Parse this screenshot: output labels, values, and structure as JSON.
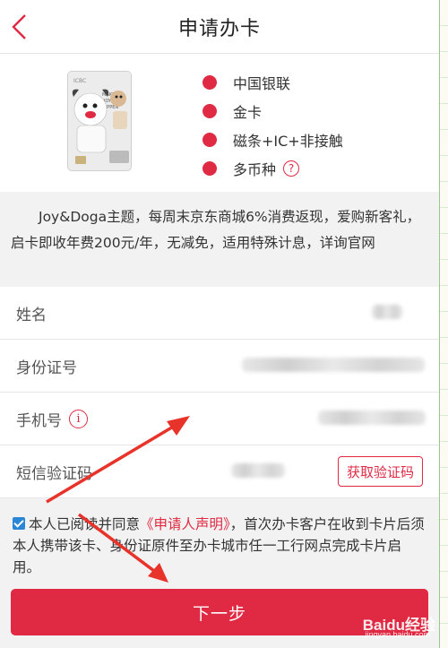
{
  "header": {
    "title": "申请办卡"
  },
  "card": {
    "features": [
      "中国银联",
      "金卡",
      "磁条+IC+非接触",
      "多币种"
    ],
    "help_icon": "?",
    "image_text": {
      "bank": "ICBC",
      "slogan_line1": "MAKE",
      "slogan_line2": "JOY",
      "slogan_line3": "HAPPEN"
    }
  },
  "description": "Joy&Doga主题，每周末京东商城6%消费返现，爱购新客礼，启卡即收年费200元/年，无减免，适用特殊计息，详询官网",
  "form": {
    "name_label": "姓名",
    "id_label": "身份证号",
    "phone_label": "手机号",
    "phone_info_icon": "i",
    "sms_label": "短信验证码",
    "get_code_label": "获取验证码"
  },
  "agreement": {
    "prefix": "本人已阅读并同意",
    "link": "《申请人声明》",
    "suffix": "，首次办卡客户在收到卡片后须本人携带该卡、身份证原件至办卡城市任一工行网点完成卡片启用。"
  },
  "next_button": "下一步",
  "watermark": {
    "main": "Baidu经验",
    "sub": "jingyan.baidu.com"
  },
  "colors": {
    "accent": "#e02a43",
    "checkbox": "#2a86d6",
    "annotation_arrow": "#e8332b"
  }
}
